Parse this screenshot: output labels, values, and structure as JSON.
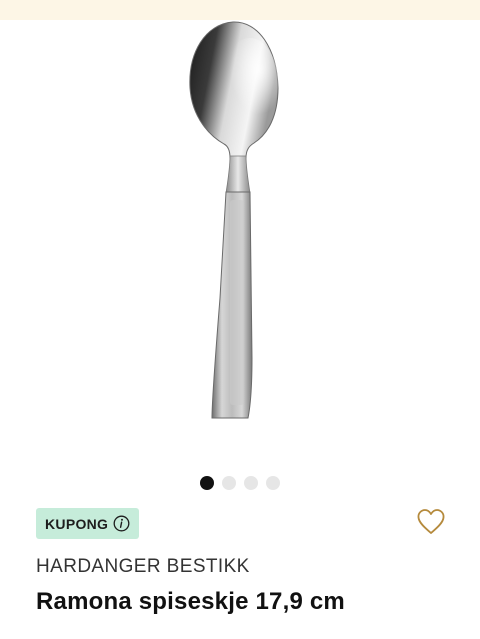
{
  "banner": {
    "color": "#fdf6e6"
  },
  "product": {
    "image_icon": "spoon-image",
    "brand": "HARDANGER BESTIKK",
    "title": "Ramona spiseskje 17,9 cm"
  },
  "carousel": {
    "total_slides": 4,
    "active_index": 0
  },
  "coupon": {
    "label": "KUPONG",
    "icon": "info-icon",
    "background": "#c6ecda"
  },
  "wishlist": {
    "icon": "heart-outline-icon",
    "color": "#b58a3c"
  }
}
